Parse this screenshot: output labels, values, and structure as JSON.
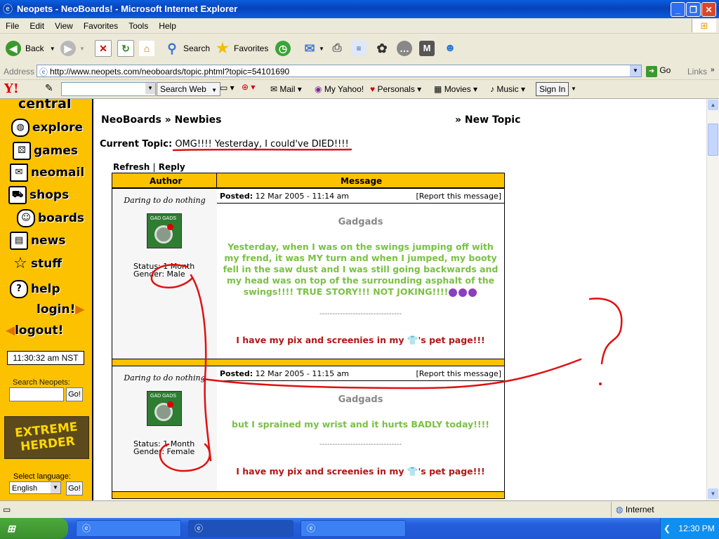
{
  "window": {
    "title": "Neopets - NeoBoards! - Microsoft Internet Explorer",
    "minimize_label": "_",
    "maximize_label": "❐",
    "close_label": "✕"
  },
  "menu": [
    "File",
    "Edit",
    "View",
    "Favorites",
    "Tools",
    "Help"
  ],
  "toolbar": {
    "back": "Back",
    "search": "Search",
    "favorites": "Favorites"
  },
  "address": {
    "label": "Address",
    "url": "http://www.neopets.com/neoboards/topic.phtml?topic=54101690",
    "go": "Go",
    "links": "Links"
  },
  "yahoo": {
    "logo": "Y!",
    "search_web": "Search Web",
    "mail": "Mail",
    "my_yahoo": "My Yahoo!",
    "personals": "Personals",
    "movies": "Movies",
    "music": "Music",
    "sign_in": "Sign In"
  },
  "nav": {
    "logo_fragment": "central",
    "items": [
      "explore",
      "games",
      "neomail",
      "shops",
      "boards",
      "news",
      "stuff",
      "help",
      "login!",
      "logout!"
    ],
    "clock": "11:30:32 am NST",
    "search_label": "Search Neopets:",
    "go": "Go!",
    "banner": "EXTREME HERDER",
    "language_label": "Select language:",
    "language_value": "English"
  },
  "board": {
    "breadcrumb": "NeoBoards » Newbies",
    "new_topic": "» New Topic",
    "current_topic_label": "Current Topic:",
    "current_topic": "OMG!!!! Yesterday, I could've DIED!!!!",
    "refresh": "Refresh",
    "sep": "|",
    "reply": "Reply",
    "col_author": "Author",
    "col_message": "Message",
    "posts": [
      {
        "author_title": "Daring to do nothing",
        "avatar_text": "GAD GADS",
        "status": "Status: 1 Month",
        "gender": "Gender: Male",
        "posted_label": "Posted:",
        "posted": "12 Mar 2005 - 11:14 am",
        "report": "[Report this message]",
        "username": "Gadgads",
        "body": "Yesterday, when I was on the swings jumping off with my frend, it was MY turn and when I jumped, my booty fell in the saw dust and I was still going backwards and my head was on top of the surrounding asphalt of the swings!!!! TRUE STORY!!! NOT JOKING!!!!",
        "divider": "--------------------------------",
        "sig_before": "I have my pix and screenies in my",
        "sig_after": "'s pet page!!!"
      },
      {
        "author_title": "Daring to do nothing",
        "avatar_text": "GAD GADS",
        "status": "Status: 1 Month",
        "gender": "Gender: Female",
        "posted_label": "Posted:",
        "posted": "12 Mar 2005 - 11:15 am",
        "report": "[Report this message]",
        "username": "Gadgads",
        "body": "but I sprained my wrist and it hurts BADLY today!!!!",
        "divider": "--------------------------------",
        "sig_before": "I have my pix and screenies in my",
        "sig_after": "'s pet page!!!"
      }
    ]
  },
  "status": {
    "zone": "Internet"
  },
  "taskbar": {
    "start": "start",
    "time": "12:30 PM"
  },
  "colors": {
    "neopets_yellow": "#fcc200",
    "post_green": "#7ac143",
    "sig_red": "#b41515",
    "scribble_red": "#e01010"
  }
}
